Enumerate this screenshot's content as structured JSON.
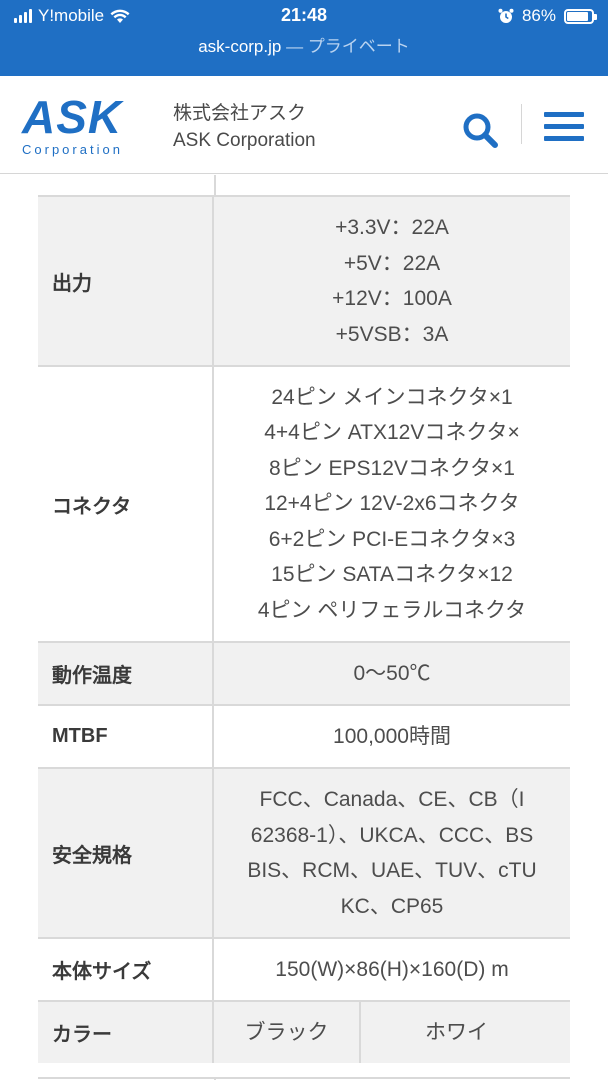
{
  "status_bar": {
    "carrier": "Y!mobile",
    "time": "21:48",
    "battery_percent": "86%",
    "battery_level": 0.86
  },
  "url_bar": {
    "domain": "ask-corp.jp",
    "separator": " — ",
    "mode": "プライベート"
  },
  "header": {
    "logo_main": "ASK",
    "logo_sub": "Corporation",
    "company_jp": "株式会社アスク",
    "company_en": "ASK Corporation"
  },
  "spec_rows": [
    {
      "label": "出力",
      "values": [
        "+3.3V：22A",
        "+5V：22A",
        "+12V：100A",
        "+5VSB：3A"
      ]
    },
    {
      "label": "コネクタ",
      "values": [
        "24ピン メインコネクタ×1",
        "4+4ピン ATX12Vコネクタ×",
        "8ピン EPS12Vコネクタ×1",
        "12+4ピン 12V-2x6コネクタ",
        "6+2ピン PCI-Eコネクタ×3",
        "15ピン SATAコネクタ×12",
        "4ピン ペリフェラルコネクタ"
      ]
    },
    {
      "label": "動作温度",
      "values": [
        "0〜50℃"
      ]
    },
    {
      "label": "MTBF",
      "values": [
        "100,000時間"
      ]
    },
    {
      "label": "安全規格",
      "values": [
        "FCC、Canada、CE、CB（I",
        "62368-1）、UKCA、CCC、BS",
        "BIS、RCM、UAE、TUV、cTU",
        "KC、CP65"
      ]
    },
    {
      "label": "本体サイズ",
      "values": [
        "150(W)×86(H)×160(D) m"
      ]
    },
    {
      "label": "カラー",
      "values": [
        "ブラック",
        "ホワイ"
      ]
    }
  ]
}
